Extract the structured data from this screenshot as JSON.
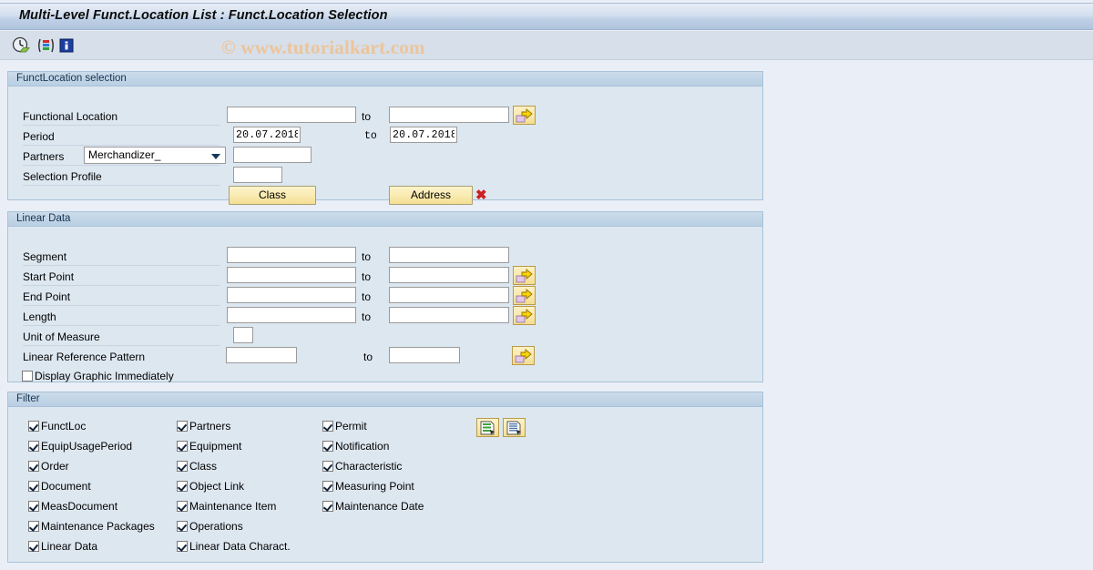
{
  "window": {
    "title": "Multi-Level Funct.Location List : Funct.Location Selection"
  },
  "toolbar": {
    "buttons": [
      {
        "name": "execute-clock-icon",
        "tooltip": "Execute"
      },
      {
        "name": "colored-bars-icon",
        "tooltip": "Selection Options"
      },
      {
        "name": "info-icon",
        "tooltip": "Information"
      }
    ]
  },
  "watermark": "© www.tutorialkart.com",
  "sections": {
    "functlocation": {
      "header": "FunctLocation selection",
      "rows": {
        "functional_location": {
          "label": "Functional Location",
          "from_value": "",
          "to_label": "to",
          "to_value": "",
          "has_arrow": true
        },
        "period": {
          "label": "Period",
          "from_value": "20.07.2018",
          "to_label": "to",
          "to_value": "20.07.2018",
          "has_arrow": false
        },
        "partners": {
          "label": "Partners",
          "select_value": "Merchandizer_",
          "value": ""
        },
        "selection_profile": {
          "label": "Selection Profile",
          "value": ""
        }
      },
      "buttons": {
        "class": "Class",
        "address": "Address",
        "delete_icon": "delete-x-icon"
      }
    },
    "linear_data": {
      "header": "Linear Data",
      "rows": [
        {
          "label": "Segment",
          "from_value": "",
          "to_label": "to",
          "to_value": "",
          "has_arrow": false
        },
        {
          "label": "Start Point",
          "from_value": "",
          "to_label": "to",
          "to_value": "",
          "has_arrow": true
        },
        {
          "label": "End Point",
          "from_value": "",
          "to_label": "to",
          "to_value": "",
          "has_arrow": true
        },
        {
          "label": "Length",
          "from_value": "",
          "to_label": "to",
          "to_value": "",
          "has_arrow": true
        }
      ],
      "unit_of_measure": {
        "label": "Unit of Measure",
        "value": ""
      },
      "linear_reference_pattern": {
        "label": "Linear Reference Pattern",
        "from_value": "",
        "to_label": "to",
        "to_value": "",
        "has_arrow": true
      },
      "display_graphic": {
        "label": "Display Graphic Immediately",
        "checked": false
      }
    },
    "filter": {
      "header": "Filter",
      "columns": [
        [
          {
            "label": "FunctLoc",
            "checked": true
          },
          {
            "label": "EquipUsagePeriod",
            "checked": true
          },
          {
            "label": "Order",
            "checked": true
          },
          {
            "label": "Document",
            "checked": true
          },
          {
            "label": "MeasDocument",
            "checked": true
          },
          {
            "label": "Maintenance Packages",
            "checked": true
          },
          {
            "label": "Linear Data",
            "checked": true
          }
        ],
        [
          {
            "label": "Partners",
            "checked": true
          },
          {
            "label": "Equipment",
            "checked": true
          },
          {
            "label": "Class",
            "checked": true
          },
          {
            "label": "Object Link",
            "checked": true
          },
          {
            "label": "Maintenance Item",
            "checked": true
          },
          {
            "label": "Operations",
            "checked": true
          },
          {
            "label": "Linear Data Charact.",
            "checked": true
          }
        ],
        [
          {
            "label": "Permit",
            "checked": true
          },
          {
            "label": "Notification",
            "checked": true
          },
          {
            "label": "Characteristic",
            "checked": true
          },
          {
            "label": "Measuring Point",
            "checked": true
          },
          {
            "label": "Maintenance Date",
            "checked": true
          }
        ]
      ],
      "action_icons": [
        {
          "name": "select-all-list-icon"
        },
        {
          "name": "deselect-all-list-icon"
        }
      ]
    }
  },
  "colors": {
    "titlebar_accent": "#b0c4dd",
    "panel_bg": "#dde7f0",
    "page_bg": "#eaeff7",
    "button_yellow": "#f9ebb2",
    "watermark": "#edc49a",
    "delete_red": "#cc1f22"
  }
}
